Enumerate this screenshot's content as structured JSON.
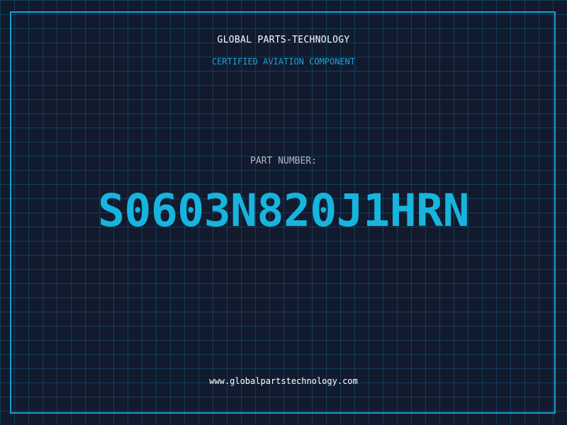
{
  "header": {
    "company_name": "GLOBAL PARTS-TECHNOLOGY",
    "tagline": "CERTIFIED AVIATION COMPONENT"
  },
  "part": {
    "label": "PART NUMBER:",
    "number": "S0603N820J1HRN"
  },
  "footer": {
    "website": "www.globalpartstechnology.com"
  },
  "colors": {
    "background": "#121a2e",
    "grid": "#165c7a",
    "accent": "#17b4dd",
    "border": "#1a9fd0",
    "label": "#b0b6c3",
    "title": "#ffffff"
  }
}
